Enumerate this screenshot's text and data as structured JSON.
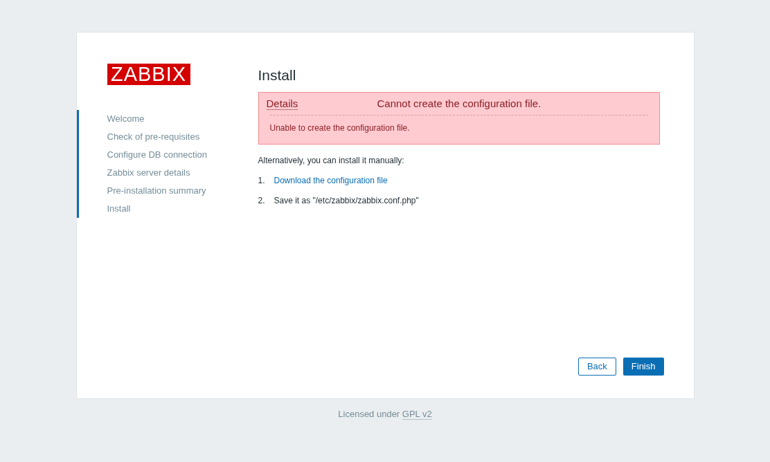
{
  "logo": "ZABBIX",
  "steps": [
    {
      "label": "Welcome",
      "done": true
    },
    {
      "label": "Check of pre-requisites",
      "done": true
    },
    {
      "label": "Configure DB connection",
      "done": true
    },
    {
      "label": "Zabbix server details",
      "done": true
    },
    {
      "label": "Pre-installation summary",
      "done": true
    },
    {
      "label": "Install",
      "done": true
    }
  ],
  "title": "Install",
  "error": {
    "toggle": "Details",
    "message": "Cannot create the configuration file.",
    "details": "Unable to create the configuration file."
  },
  "intro": "Alternatively, you can install it manually:",
  "instructions": [
    {
      "number": "1.",
      "kind": "link",
      "text": "Download the configuration file"
    },
    {
      "number": "2.",
      "kind": "text",
      "text": "Save it as \"/etc/zabbix/zabbix.conf.php\""
    }
  ],
  "buttons": {
    "back": "Back",
    "finish": "Finish"
  },
  "footer": {
    "text": "Licensed under",
    "link": "GPL v2"
  }
}
